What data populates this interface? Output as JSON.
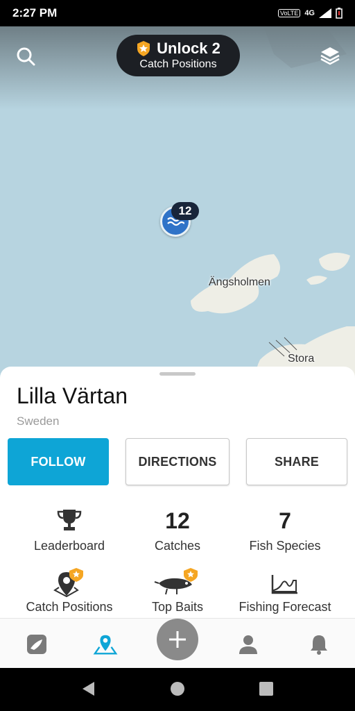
{
  "status_bar": {
    "time": "2:27 PM",
    "volte": "VoLTE",
    "network": "4G"
  },
  "map": {
    "labels": {
      "island": "Ängsholmen",
      "stora": "Stora"
    },
    "marker": {
      "count": "12",
      "icon": "waves-icon",
      "color": "#2f73c8"
    }
  },
  "unlock_banner": {
    "title": "Unlock 2",
    "subtitle": "Catch Positions",
    "icon": "shield-star-icon"
  },
  "place": {
    "name": "Lilla Värtan",
    "country": "Sweden"
  },
  "actions": {
    "follow": "FOLLOW",
    "directions": "DIRECTIONS",
    "share": "SHARE",
    "accent": "#0ea5d6"
  },
  "stats": {
    "leaderboard": {
      "label": "Leaderboard",
      "icon": "trophy-icon"
    },
    "catches": {
      "value": "12",
      "label": "Catches"
    },
    "species": {
      "value": "7",
      "label": "Fish Species"
    },
    "catch_positions": {
      "label": "Catch Positions",
      "icon": "map-pin-icon",
      "premium": true
    },
    "top_baits": {
      "label": "Top Baits",
      "icon": "lure-icon",
      "premium": true
    },
    "forecast": {
      "label": "Fishing Forecast",
      "icon": "chart-icon"
    }
  },
  "bottom_nav": {
    "items": [
      "feed",
      "map",
      "add",
      "profile",
      "notifications"
    ],
    "active": "map",
    "active_color": "#0ea5d6"
  }
}
